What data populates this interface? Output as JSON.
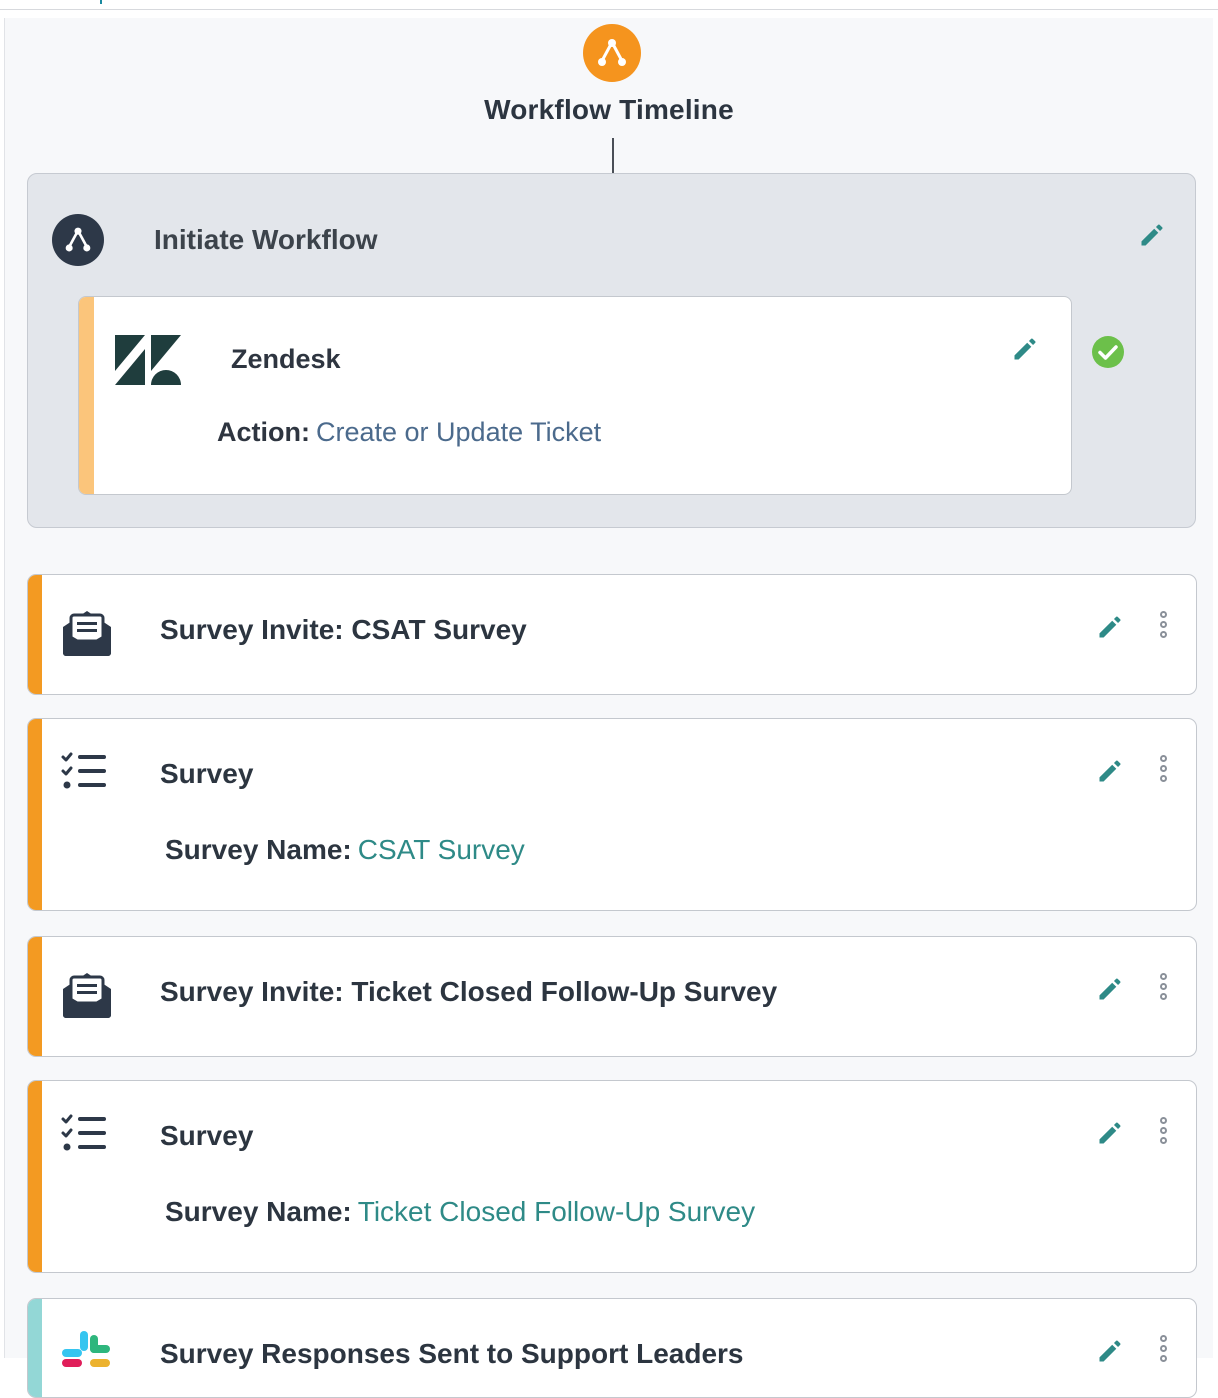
{
  "header": {
    "title": "Workflow Timeline",
    "icon": "workflow-icon",
    "accent_color": "#f5941e"
  },
  "initiate": {
    "title": "Initiate Workflow",
    "icon": "workflow-icon",
    "integration": {
      "name": "Zendesk",
      "logo": "zendesk-logo",
      "action_label": "Action:",
      "action_value": "Create or Update Ticket",
      "status_icon": "check-circle-icon"
    }
  },
  "steps": [
    {
      "title": "Survey Invite: CSAT Survey",
      "icon": "envelope-survey-icon",
      "accent": "#f39a22"
    },
    {
      "title": "Survey",
      "icon": "checklist-icon",
      "sub_label": "Survey Name:",
      "sub_value": "CSAT Survey",
      "accent": "#f39a22"
    },
    {
      "title": "Survey Invite: Ticket Closed Follow-Up Survey",
      "icon": "envelope-survey-icon",
      "accent": "#f39a22"
    },
    {
      "title": "Survey",
      "icon": "checklist-icon",
      "sub_label": "Survey Name:",
      "sub_value": "Ticket Closed Follow-Up Survey",
      "accent": "#f39a22"
    },
    {
      "title": "Survey Responses Sent to Support Leaders",
      "icon": "slack-icon",
      "accent": "#93d7d6"
    }
  ],
  "colors": {
    "edit_pencil": "#2e8a87",
    "link_teal": "#2e8a87",
    "action_blue": "#4b6a8c",
    "check_green": "#6cc04a"
  }
}
